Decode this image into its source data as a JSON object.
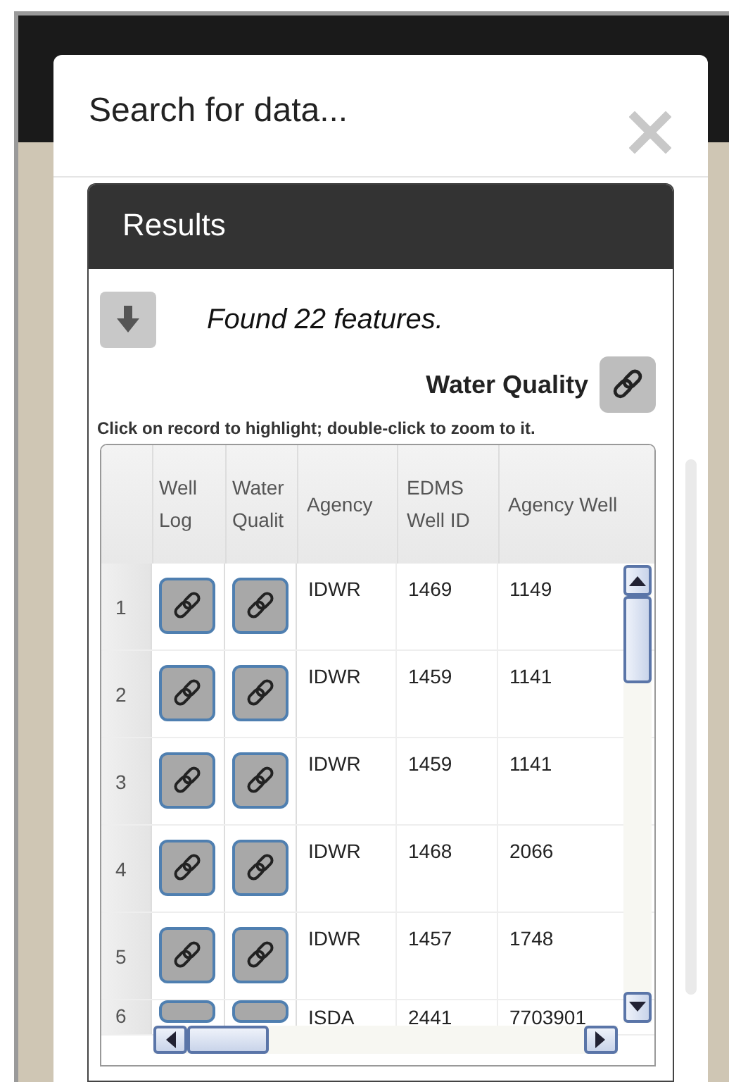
{
  "dialog": {
    "title": "Search for data..."
  },
  "results": {
    "title": "Results",
    "summary": "Found 22 features.",
    "link_label": "Water Quality",
    "instruction": "Click on record to highlight; double-click to zoom to it."
  },
  "table": {
    "columns": [
      {
        "label": "Well Log",
        "kind": "link"
      },
      {
        "label": "Water Qualit",
        "kind": "link"
      },
      {
        "label": "Agency",
        "kind": "text"
      },
      {
        "label": "EDMS Well ID",
        "kind": "text"
      },
      {
        "label": "Agency Well",
        "kind": "text"
      }
    ],
    "rows": [
      {
        "number": "1",
        "cells": [
          "",
          "",
          "IDWR",
          "1469",
          "1149"
        ]
      },
      {
        "number": "2",
        "cells": [
          "",
          "",
          "IDWR",
          "1459",
          "1141"
        ]
      },
      {
        "number": "3",
        "cells": [
          "",
          "",
          "IDWR",
          "1459",
          "1141"
        ]
      },
      {
        "number": "4",
        "cells": [
          "",
          "",
          "IDWR",
          "1468",
          "2066"
        ]
      },
      {
        "number": "5",
        "cells": [
          "",
          "",
          "IDWR",
          "1457",
          "1748"
        ]
      },
      {
        "number": "6",
        "cells": [
          "",
          "",
          "ISDA",
          "2441",
          "7703901"
        ]
      }
    ]
  }
}
